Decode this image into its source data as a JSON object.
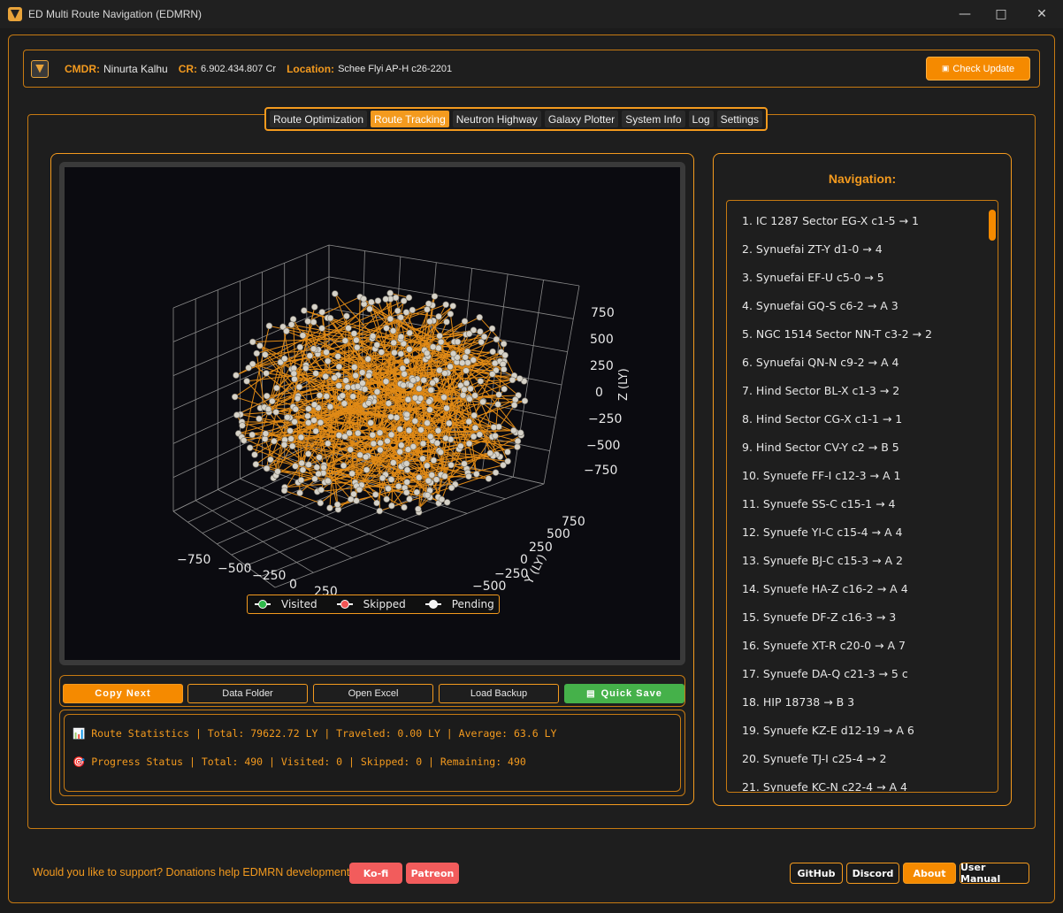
{
  "window": {
    "title": "ED Multi Route Navigation (EDMRN)"
  },
  "header": {
    "cmdr_label": "CMDR:",
    "cmdr_value": "Ninurta Kalhu",
    "cr_label": "CR:",
    "cr_value": "6.902.434.807 Cr",
    "location_label": "Location:",
    "location_value": "Schee Flyi AP-H c26-2201",
    "check_update": "Check Update"
  },
  "tabs": [
    "Route Optimization",
    "Route Tracking",
    "Neutron Highway",
    "Galaxy Plotter",
    "System Info",
    "Log",
    "Settings"
  ],
  "active_tab": "Route Tracking",
  "plot": {
    "z_label": "Z (LY)",
    "y_label": "Y (LY)",
    "z_ticks": [
      "750",
      "500",
      "250",
      "0",
      "−250",
      "−500",
      "−750"
    ],
    "y_ticks": [
      "750",
      "500",
      "250",
      "0",
      "−250",
      "−500"
    ],
    "x_ticks": [
      "−750",
      "−500",
      "−250",
      "0",
      "250"
    ],
    "legend": [
      {
        "label": "Visited",
        "color": "#2fb84a"
      },
      {
        "label": "Skipped",
        "color": "#f05454"
      },
      {
        "label": "Pending",
        "color": "#f2f2f2"
      }
    ]
  },
  "actions": {
    "copy_next": "Copy Next",
    "data_folder": "Data Folder",
    "open_excel": "Open Excel",
    "load_backup": "Load Backup",
    "quick_save": "Quick Save"
  },
  "stats": {
    "route": "📊 Route Statistics | Total: 79622.72 LY | Traveled: 0.00 LY | Average: 63.6 LY",
    "progress": "🎯 Progress Status | Total: 490 | Visited: 0 | Skipped: 0 | Remaining: 490"
  },
  "navigation": {
    "title": "Navigation:",
    "items": [
      "1. IC 1287 Sector EG-X c1-5 → 1",
      "2. Synuefai ZT-Y d1-0 → 4",
      "3. Synuefai EF-U c5-0 → 5",
      "4. Synuefai GQ-S c6-2 → A 3",
      "5. NGC 1514 Sector NN-T c3-2 → 2",
      "6. Synuefai QN-N c9-2 → A 4",
      "7. Hind Sector BL-X c1-3 → 2",
      "8. Hind Sector CG-X c1-1 → 1",
      "9. Hind Sector CV-Y c2 → B 5",
      "10. Synuefe FF-I c12-3 → A 1",
      "11. Synuefe SS-C c15-1 → 4",
      "12. Synuefe YI-C c15-4 → A 4",
      "13. Synuefe BJ-C c15-3 → A 2",
      "14. Synuefe HA-Z c16-2 → A 4",
      "15. Synuefe DF-Z c16-3 → 3",
      "16. Synuefe XT-R c20-0 → A 7",
      "17. Synuefe DA-Q c21-3 → 5 c",
      "18. HIP 18738 → B 3",
      "19. Synuefe KZ-E d12-19 → A 6",
      "20. Synuefe TJ-I c25-4 → 2",
      "21. Synuefe KC-N c22-4 → A 4"
    ]
  },
  "footer": {
    "support_text": "Would you like to support? Donations help EDMRN development!",
    "kofi": "Ko-fi",
    "patreon": "Patreon",
    "github": "GitHub",
    "discord": "Discord",
    "about": "About",
    "manual": "User Manual"
  }
}
